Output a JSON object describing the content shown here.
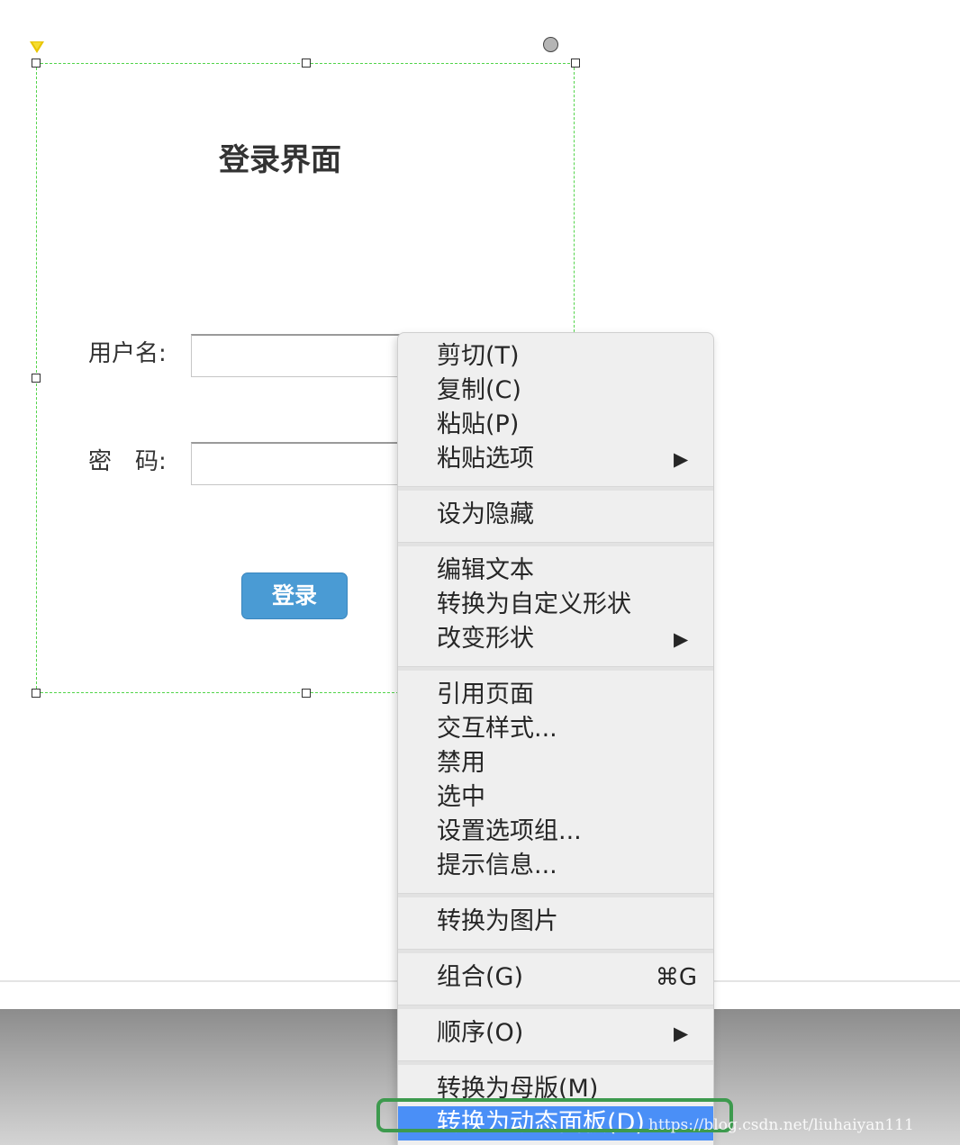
{
  "form": {
    "title": "登录界面",
    "username_label": "用户名:",
    "password_label": "密　码:",
    "username_value": "",
    "password_value": "",
    "login_button": "登录"
  },
  "context_menu": {
    "items": [
      {
        "label": "剪切(T)"
      },
      {
        "label": "复制(C)"
      },
      {
        "label": "粘贴(P)"
      },
      {
        "label": "粘贴选项",
        "arrow": "▶"
      },
      {
        "label": "设为隐藏"
      },
      {
        "label": "编辑文本"
      },
      {
        "label": "转换为自定义形状"
      },
      {
        "label": "改变形状",
        "arrow": "▶"
      },
      {
        "label": "引用页面"
      },
      {
        "label": "交互样式..."
      },
      {
        "label": "禁用"
      },
      {
        "label": "选中"
      },
      {
        "label": "设置选项组..."
      },
      {
        "label": "提示信息..."
      },
      {
        "label": "转换为图片"
      },
      {
        "label": "组合(G)",
        "shortcut": "⌘G"
      },
      {
        "label": "顺序(O)",
        "arrow": "▶"
      },
      {
        "label": "转换为母版(M)"
      },
      {
        "label": "转换为动态面板(D)"
      }
    ],
    "highlight_color": "#4a8ff7"
  },
  "annotation_color": "#3d9a4e",
  "watermark": "https://blog.csdn.net/liuhaiyan111"
}
